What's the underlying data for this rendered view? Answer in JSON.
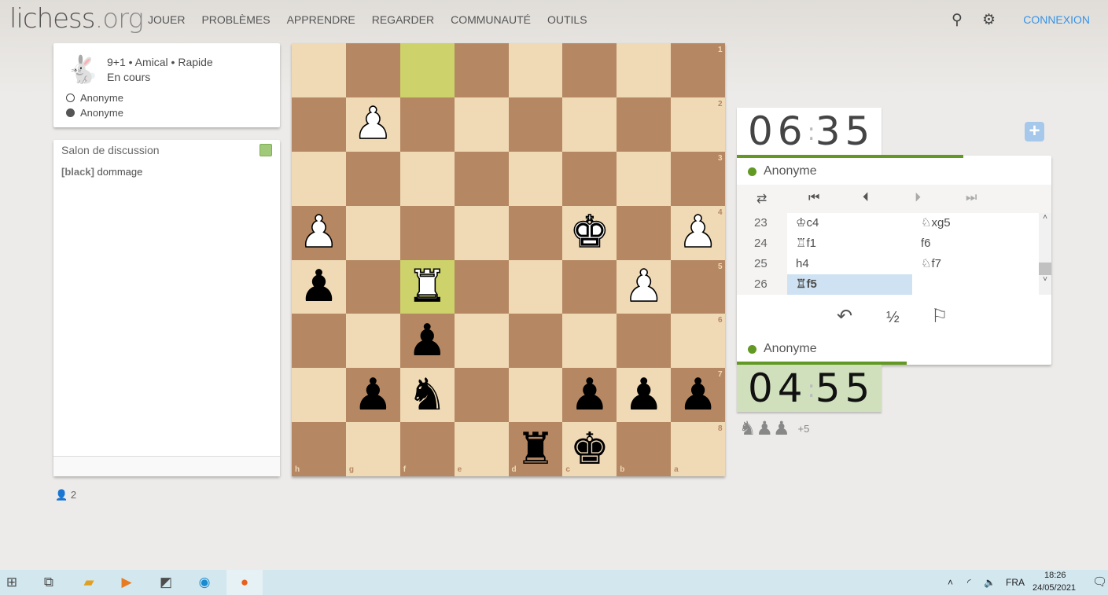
{
  "header": {
    "logo_main": "lichess",
    "logo_tld": ".org",
    "nav": [
      "JOUER",
      "PROBLÈMES",
      "APPRENDRE",
      "REGARDER",
      "COMMUNAUTÉ",
      "OUTILS"
    ],
    "login": "CONNEXION"
  },
  "game_info": {
    "line1": "9+1 • Amical • Rapide",
    "line2": "En cours",
    "white": "Anonyme",
    "black": "Anonyme"
  },
  "chat": {
    "title": "Salon de discussion",
    "messages": [
      {
        "user": "[black]",
        "text": "dommage"
      }
    ]
  },
  "spectators": "2",
  "board": {
    "orientation": "black",
    "files": [
      "h",
      "g",
      "f",
      "e",
      "d",
      "c",
      "b",
      "a"
    ],
    "ranks": [
      "1",
      "2",
      "3",
      "4",
      "5",
      "6",
      "7",
      "8"
    ],
    "last_move": [
      "f1",
      "f5"
    ],
    "light": "#f0d9b5",
    "dark": "#b58863",
    "highlight": "#cdd26a",
    "pieces": [
      {
        "sq": "g2",
        "p": "wP"
      },
      {
        "sq": "h4",
        "p": "wP"
      },
      {
        "sq": "c4",
        "p": "wK"
      },
      {
        "sq": "a4",
        "p": "wP"
      },
      {
        "sq": "h5",
        "p": "bP"
      },
      {
        "sq": "f5",
        "p": "wR"
      },
      {
        "sq": "b5",
        "p": "wP"
      },
      {
        "sq": "f6",
        "p": "bP"
      },
      {
        "sq": "g7",
        "p": "bP"
      },
      {
        "sq": "f7",
        "p": "bN"
      },
      {
        "sq": "c7",
        "p": "bP"
      },
      {
        "sq": "b7",
        "p": "bP"
      },
      {
        "sq": "a7",
        "p": "bP"
      },
      {
        "sq": "d8",
        "p": "bR"
      },
      {
        "sq": "c8",
        "p": "bK"
      }
    ]
  },
  "clocks": {
    "top": {
      "min": "06",
      "sec": "35",
      "player": "Anonyme",
      "remaining_fraction": 0.72
    },
    "bottom": {
      "min": "04",
      "sec": "55",
      "player": "Anonyme",
      "remaining_fraction": 0.54
    }
  },
  "moves": [
    {
      "n": "23",
      "w": "♔c4",
      "b": "♘xg5"
    },
    {
      "n": "24",
      "w": "♖f1",
      "b": "f6"
    },
    {
      "n": "25",
      "w": "h4",
      "b": "♘f7"
    },
    {
      "n": "26",
      "w": "♖f5",
      "b": ""
    }
  ],
  "actions": {
    "takeback": "↶",
    "draw": "½",
    "resign": "⚐"
  },
  "material": {
    "pieces": "♞♟♟",
    "diff": "+5"
  },
  "taskbar": {
    "lang": "FRA",
    "time": "18:26",
    "date": "24/05/2021"
  }
}
